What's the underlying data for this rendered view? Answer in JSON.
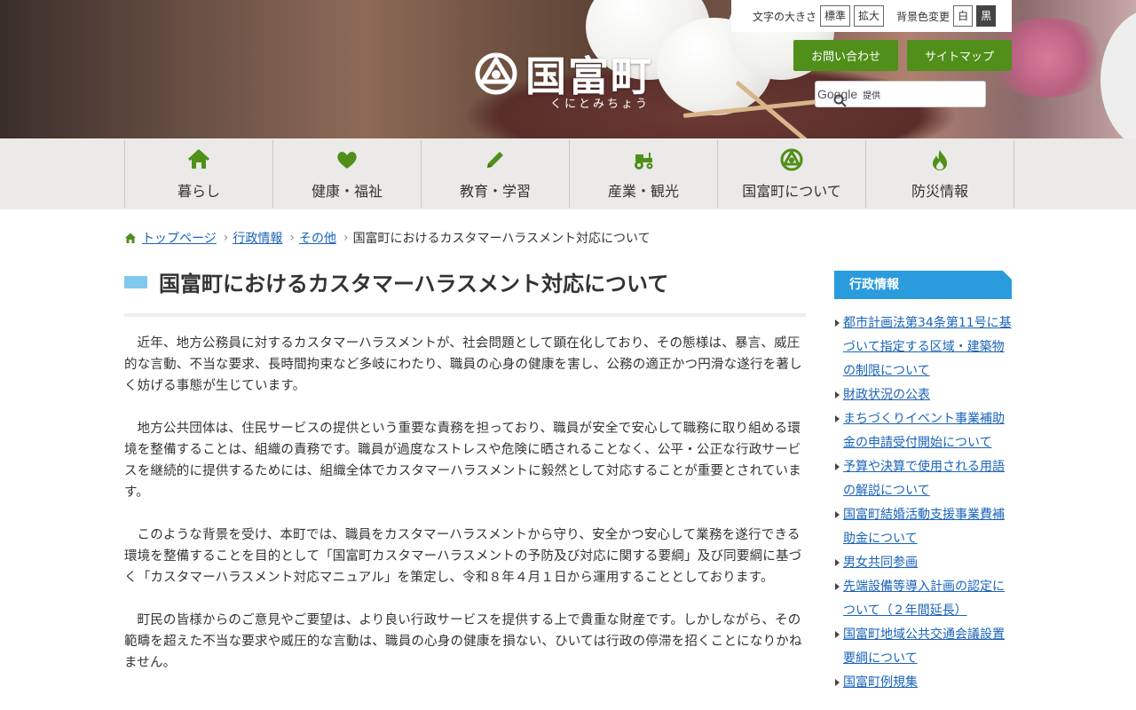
{
  "header": {
    "town_name": "国富町",
    "town_reading": "くにとみちょう",
    "font_size_label": "文字の大きさ",
    "font_standard": "標準",
    "font_large": "拡大",
    "bg_color_label": "背景色変更",
    "bg_white": "白",
    "bg_black": "黒",
    "contact_button": "お問い合わせ",
    "sitemap_button": "サイトマップ",
    "search_brand": "Google",
    "search_provided": "提供"
  },
  "nav": {
    "items": [
      {
        "label": "暮らし",
        "icon": "home-icon"
      },
      {
        "label": "健康・福祉",
        "icon": "heart-icon"
      },
      {
        "label": "教育・学習",
        "icon": "pencil-icon"
      },
      {
        "label": "産業・観光",
        "icon": "tractor-icon"
      },
      {
        "label": "国富町について",
        "icon": "town-emblem-icon"
      },
      {
        "label": "防災情報",
        "icon": "flame-icon"
      }
    ]
  },
  "breadcrumb": {
    "items": [
      "トップページ",
      "行政情報",
      "その他"
    ],
    "current": "国富町におけるカスタマーハラスメント対応について"
  },
  "main": {
    "title": "国富町におけるカスタマーハラスメント対応について",
    "paragraphs": [
      "近年、地方公務員に対するカスタマーハラスメントが、社会問題として顕在化しており、その態様は、暴言、威圧的な言動、不当な要求、長時間拘束など多岐にわたり、職員の心身の健康を害し、公務の適正かつ円滑な遂行を著しく妨げる事態が生じています。",
      "地方公共団体は、住民サービスの提供という重要な責務を担っており、職員が安全で安心して職務に取り組める環境を整備することは、組織の責務です。職員が過度なストレスや危険に晒されることなく、公平・公正な行政サービスを継続的に提供するためには、組織全体でカスタマーハラスメントに毅然として対応することが重要とされています。",
      "このような背景を受け、本町では、職員をカスタマーハラスメントから守り、安全かつ安心して業務を遂行できる環境を整備することを目的として「国富町カスタマーハラスメントの予防及び対応に関する要綱」及び同要綱に基づく「カスタマーハラスメント対応マニュアル」を策定し、令和８年４月１日から運用することとしております。",
      "町民の皆様からのご意見やご要望は、より良い行政サービスを提供する上で貴重な財産です。しかしながら、その範疇を超えた不当な要求や威圧的な言動は、職員の心身の健康を損ない、ひいては行政の停滞を招くことになりかねません。"
    ]
  },
  "sidebar": {
    "title": "行政情報",
    "links": [
      "都市計画法第34条第11号に基づいて指定する区域・建築物の制限について",
      "財政状況の公表",
      "まちづくりイベント事業補助金の申請受付開始について",
      "予算や決算で使用される用語の解説について",
      "国富町結婚活動支援事業費補助金について",
      "男女共同参画",
      "先端設備等導入計画の認定について（２年間延長）",
      "国富町地域公共交通会議設置要綱について",
      "国富町例規集"
    ]
  },
  "colors": {
    "nav_icon": "#4f8f1a",
    "button_green": "#4f8f1a",
    "link": "#1a63b8",
    "sidebar_head": "#2a9bdd",
    "title_bar": "#7fc8ee"
  }
}
